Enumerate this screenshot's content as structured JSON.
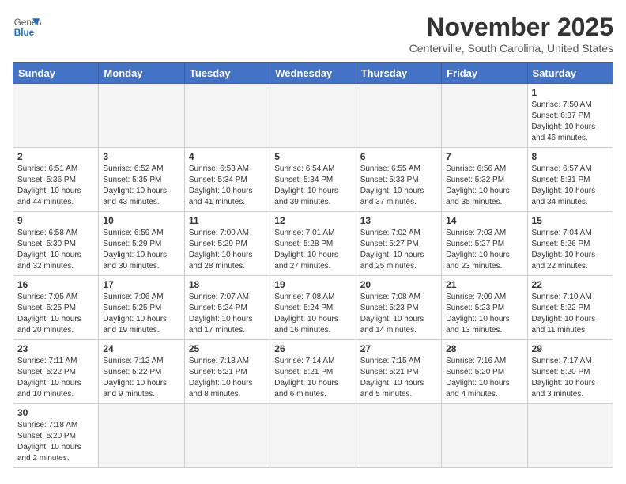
{
  "header": {
    "logo_general": "General",
    "logo_blue": "Blue",
    "month_title": "November 2025",
    "location": "Centerville, South Carolina, United States"
  },
  "days_of_week": [
    "Sunday",
    "Monday",
    "Tuesday",
    "Wednesday",
    "Thursday",
    "Friday",
    "Saturday"
  ],
  "weeks": [
    [
      {
        "day": "",
        "info": ""
      },
      {
        "day": "",
        "info": ""
      },
      {
        "day": "",
        "info": ""
      },
      {
        "day": "",
        "info": ""
      },
      {
        "day": "",
        "info": ""
      },
      {
        "day": "",
        "info": ""
      },
      {
        "day": "1",
        "info": "Sunrise: 7:50 AM\nSunset: 6:37 PM\nDaylight: 10 hours and 46 minutes."
      }
    ],
    [
      {
        "day": "2",
        "info": "Sunrise: 6:51 AM\nSunset: 5:36 PM\nDaylight: 10 hours and 44 minutes."
      },
      {
        "day": "3",
        "info": "Sunrise: 6:52 AM\nSunset: 5:35 PM\nDaylight: 10 hours and 43 minutes."
      },
      {
        "day": "4",
        "info": "Sunrise: 6:53 AM\nSunset: 5:34 PM\nDaylight: 10 hours and 41 minutes."
      },
      {
        "day": "5",
        "info": "Sunrise: 6:54 AM\nSunset: 5:34 PM\nDaylight: 10 hours and 39 minutes."
      },
      {
        "day": "6",
        "info": "Sunrise: 6:55 AM\nSunset: 5:33 PM\nDaylight: 10 hours and 37 minutes."
      },
      {
        "day": "7",
        "info": "Sunrise: 6:56 AM\nSunset: 5:32 PM\nDaylight: 10 hours and 35 minutes."
      },
      {
        "day": "8",
        "info": "Sunrise: 6:57 AM\nSunset: 5:31 PM\nDaylight: 10 hours and 34 minutes."
      }
    ],
    [
      {
        "day": "9",
        "info": "Sunrise: 6:58 AM\nSunset: 5:30 PM\nDaylight: 10 hours and 32 minutes."
      },
      {
        "day": "10",
        "info": "Sunrise: 6:59 AM\nSunset: 5:29 PM\nDaylight: 10 hours and 30 minutes."
      },
      {
        "day": "11",
        "info": "Sunrise: 7:00 AM\nSunset: 5:29 PM\nDaylight: 10 hours and 28 minutes."
      },
      {
        "day": "12",
        "info": "Sunrise: 7:01 AM\nSunset: 5:28 PM\nDaylight: 10 hours and 27 minutes."
      },
      {
        "day": "13",
        "info": "Sunrise: 7:02 AM\nSunset: 5:27 PM\nDaylight: 10 hours and 25 minutes."
      },
      {
        "day": "14",
        "info": "Sunrise: 7:03 AM\nSunset: 5:27 PM\nDaylight: 10 hours and 23 minutes."
      },
      {
        "day": "15",
        "info": "Sunrise: 7:04 AM\nSunset: 5:26 PM\nDaylight: 10 hours and 22 minutes."
      }
    ],
    [
      {
        "day": "16",
        "info": "Sunrise: 7:05 AM\nSunset: 5:25 PM\nDaylight: 10 hours and 20 minutes."
      },
      {
        "day": "17",
        "info": "Sunrise: 7:06 AM\nSunset: 5:25 PM\nDaylight: 10 hours and 19 minutes."
      },
      {
        "day": "18",
        "info": "Sunrise: 7:07 AM\nSunset: 5:24 PM\nDaylight: 10 hours and 17 minutes."
      },
      {
        "day": "19",
        "info": "Sunrise: 7:08 AM\nSunset: 5:24 PM\nDaylight: 10 hours and 16 minutes."
      },
      {
        "day": "20",
        "info": "Sunrise: 7:08 AM\nSunset: 5:23 PM\nDaylight: 10 hours and 14 minutes."
      },
      {
        "day": "21",
        "info": "Sunrise: 7:09 AM\nSunset: 5:23 PM\nDaylight: 10 hours and 13 minutes."
      },
      {
        "day": "22",
        "info": "Sunrise: 7:10 AM\nSunset: 5:22 PM\nDaylight: 10 hours and 11 minutes."
      }
    ],
    [
      {
        "day": "23",
        "info": "Sunrise: 7:11 AM\nSunset: 5:22 PM\nDaylight: 10 hours and 10 minutes."
      },
      {
        "day": "24",
        "info": "Sunrise: 7:12 AM\nSunset: 5:22 PM\nDaylight: 10 hours and 9 minutes."
      },
      {
        "day": "25",
        "info": "Sunrise: 7:13 AM\nSunset: 5:21 PM\nDaylight: 10 hours and 8 minutes."
      },
      {
        "day": "26",
        "info": "Sunrise: 7:14 AM\nSunset: 5:21 PM\nDaylight: 10 hours and 6 minutes."
      },
      {
        "day": "27",
        "info": "Sunrise: 7:15 AM\nSunset: 5:21 PM\nDaylight: 10 hours and 5 minutes."
      },
      {
        "day": "28",
        "info": "Sunrise: 7:16 AM\nSunset: 5:20 PM\nDaylight: 10 hours and 4 minutes."
      },
      {
        "day": "29",
        "info": "Sunrise: 7:17 AM\nSunset: 5:20 PM\nDaylight: 10 hours and 3 minutes."
      }
    ],
    [
      {
        "day": "30",
        "info": "Sunrise: 7:18 AM\nSunset: 5:20 PM\nDaylight: 10 hours and 2 minutes."
      },
      {
        "day": "",
        "info": ""
      },
      {
        "day": "",
        "info": ""
      },
      {
        "day": "",
        "info": ""
      },
      {
        "day": "",
        "info": ""
      },
      {
        "day": "",
        "info": ""
      },
      {
        "day": "",
        "info": ""
      }
    ]
  ]
}
